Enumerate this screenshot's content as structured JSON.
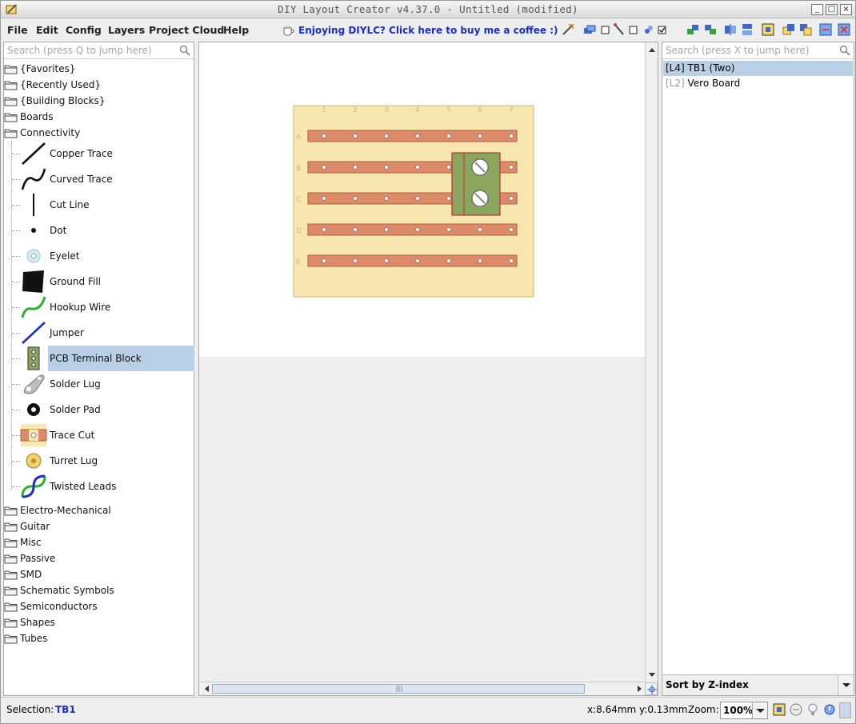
{
  "window": {
    "title": "DIY Layout Creator v4.37.0 - Untitled  (modified)",
    "controls": [
      "_",
      "□",
      "×"
    ]
  },
  "menu": {
    "items": [
      "File",
      "Edit",
      "Config",
      "Layers",
      "Project Cloud",
      "Help"
    ],
    "promo": "Enjoying DIYLC? Click here to buy me a coffee :)"
  },
  "left_panel": {
    "search_placeholder": "Search (press Q to jump here)",
    "folders_top": [
      "{Favorites}",
      "{Recently Used}",
      "{Building Blocks}",
      "Boards",
      "Connectivity"
    ],
    "connectivity_items": [
      {
        "label": "Copper Trace",
        "icon": "copper-trace-icon"
      },
      {
        "label": "Curved Trace",
        "icon": "curved-trace-icon"
      },
      {
        "label": "Cut Line",
        "icon": "cut-line-icon"
      },
      {
        "label": "Dot",
        "icon": "dot-icon"
      },
      {
        "label": "Eyelet",
        "icon": "eyelet-icon"
      },
      {
        "label": "Ground Fill",
        "icon": "ground-fill-icon"
      },
      {
        "label": "Hookup Wire",
        "icon": "hookup-wire-icon"
      },
      {
        "label": "Jumper",
        "icon": "jumper-icon"
      },
      {
        "label": "PCB Terminal Block",
        "icon": "pcb-terminal-block-icon"
      },
      {
        "label": "Solder Lug",
        "icon": "solder-lug-icon"
      },
      {
        "label": "Solder Pad",
        "icon": "solder-pad-icon"
      },
      {
        "label": "Trace Cut",
        "icon": "trace-cut-icon"
      },
      {
        "label": "Turret Lug",
        "icon": "turret-lug-icon"
      },
      {
        "label": "Twisted Leads",
        "icon": "twisted-leads-icon"
      }
    ],
    "selected_item": "PCB Terminal Block",
    "folders_bottom": [
      "Electro-Mechanical",
      "Guitar",
      "Misc",
      "Passive",
      "SMD",
      "Schematic Symbols",
      "Semiconductors",
      "Shapes",
      "Tubes"
    ]
  },
  "board": {
    "columns": [
      "1",
      "2",
      "3",
      "4",
      "5",
      "6",
      "7"
    ],
    "rows": [
      "A",
      "B",
      "C",
      "D",
      "E"
    ],
    "colors": {
      "board": "#f7e6b0",
      "strip": "#dd8a6a",
      "terminal": "#8aa55e",
      "border": "#c43030"
    }
  },
  "right_panel": {
    "search_placeholder": "Search (press X to jump here)",
    "layers": [
      {
        "tag": "[L4]",
        "name": "TB1 (Two)",
        "selected": true
      },
      {
        "tag": "[L2]",
        "name": "Vero Board",
        "selected": false
      }
    ],
    "sort_label": "Sort by Z-index"
  },
  "status": {
    "selection_label": "Selection:",
    "selection_value": "TB1",
    "coords": "x:8.64mm y:0.13mm",
    "zoom_label": "Zoom:",
    "zoom_value": "100%"
  }
}
